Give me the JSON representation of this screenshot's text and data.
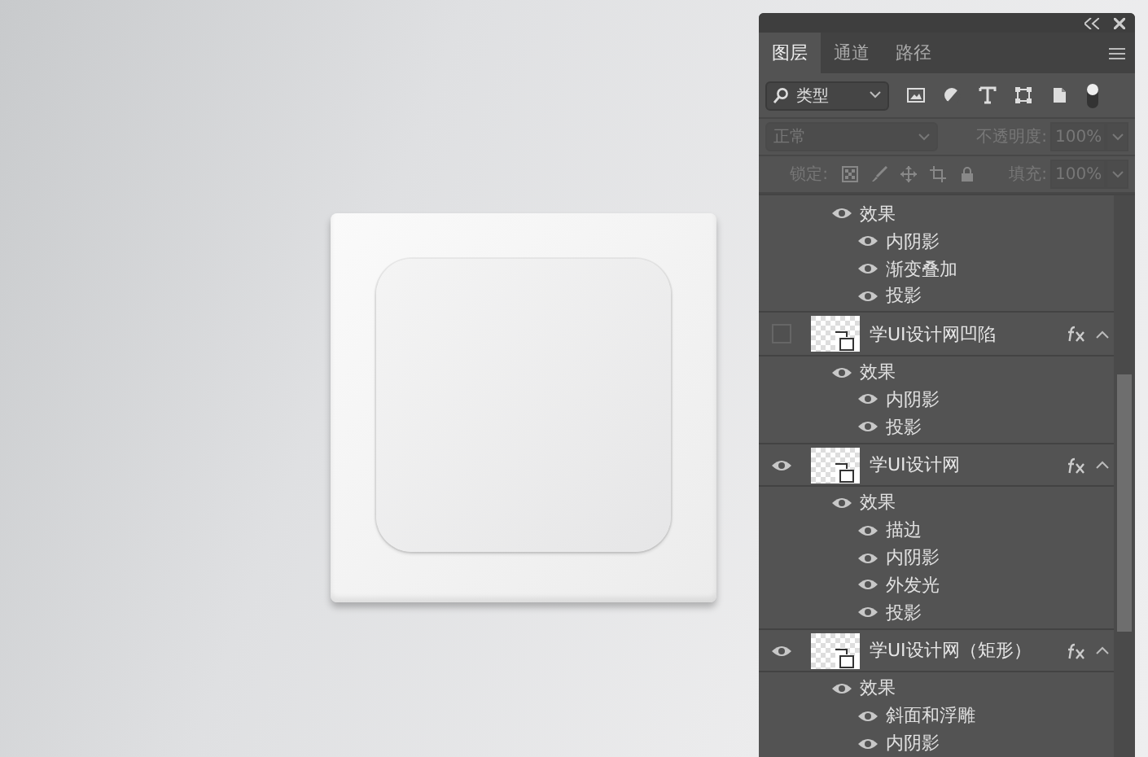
{
  "panel": {
    "tabs": [
      {
        "label": "图层",
        "selected": true
      },
      {
        "label": "通道",
        "selected": false
      },
      {
        "label": "路径",
        "selected": false
      }
    ],
    "filter": {
      "value": "类型"
    },
    "blend_mode": {
      "value": "正常",
      "disabled": true
    },
    "opacity": {
      "label": "不透明度:",
      "value": "100%",
      "disabled": true
    },
    "lock": {
      "label": "锁定:"
    },
    "fill": {
      "label": "填充:",
      "value": "100%",
      "disabled": true
    },
    "layers": [
      {
        "kind": "continued",
        "effects_label": "效果",
        "effects": [
          "内阴影",
          "渐变叠加",
          "投影"
        ]
      },
      {
        "kind": "layer",
        "name": "学UI设计网凹陷",
        "visible": false,
        "effects_label": "效果",
        "effects": [
          "内阴影",
          "投影"
        ]
      },
      {
        "kind": "layer",
        "name": "学UI设计网",
        "visible": true,
        "effects_label": "效果",
        "effects": [
          "描边",
          "内阴影",
          "外发光",
          "投影"
        ]
      },
      {
        "kind": "layer",
        "name": "学UI设计网（矩形）",
        "visible": true,
        "effects_label": "效果",
        "effects": [
          "斜面和浮雕",
          "内阴影"
        ]
      }
    ]
  }
}
